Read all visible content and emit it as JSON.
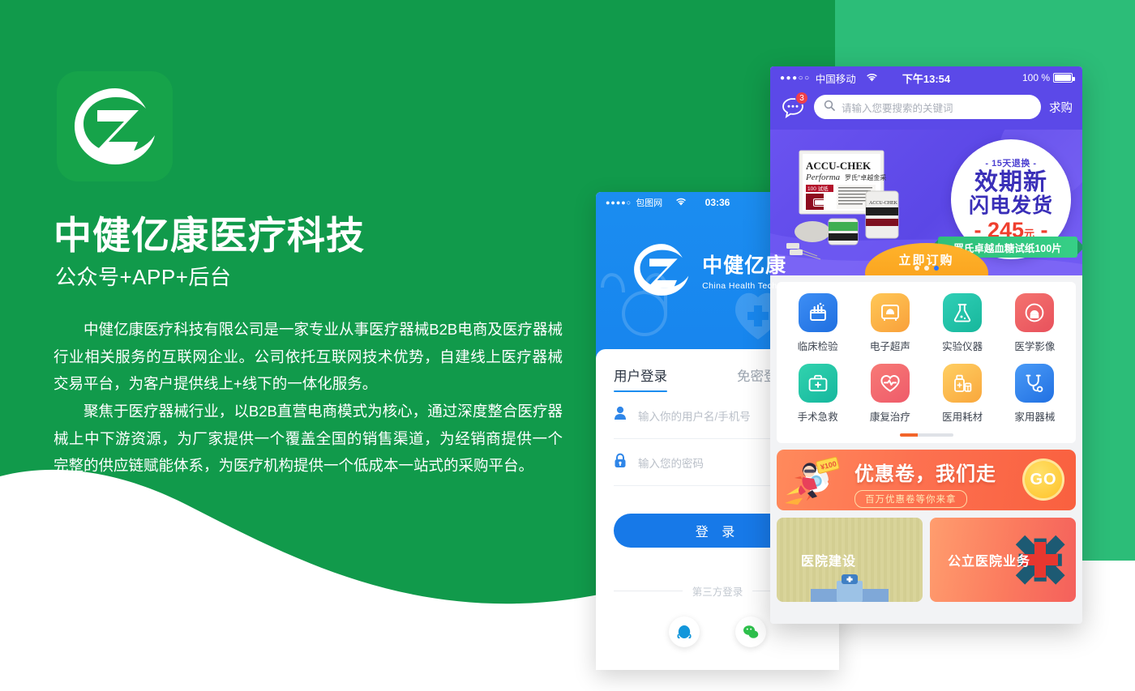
{
  "brand": {
    "logo_letter": "Z",
    "headline": "中健亿康医疗科技",
    "subhead": "公众号+APP+后台",
    "paragraph_1": "中健亿康医疗科技有限公司是一家专业从事医疗器械B2B电商及医疗器械行业相关服务的互联网企业。公司依托互联网技术优势，自建线上医疗器械交易平台，为客户提供线上+线下的一体化服务。",
    "paragraph_2": "聚焦于医疗器械行业，以B2B直营电商模式为核心，通过深度整合医疗器械上中下游资源，为厂家提供一个覆盖全国的销售渠道，为经销商提供一个完整的供应链赋能体系，为医疗机构提供一个低成本一站式的采购平台。"
  },
  "colors": {
    "green_left": "#119a4b",
    "green_right": "#2cbd78",
    "blue": "#1b8df0",
    "purple": "#5b49e8",
    "orange": "#f2642a",
    "badge_red": "#ef3f4a"
  },
  "login_phone": {
    "status": {
      "signal_dots": "●●●●○",
      "carrier": "包图网",
      "wifi_icon": "wifi-icon",
      "time": "03:36"
    },
    "brand_cn": "中健亿康",
    "brand_en": "China Health Technology",
    "tabs": [
      {
        "label": "用户登录",
        "active": true
      },
      {
        "label": "免密登录",
        "active": false
      }
    ],
    "fields": [
      {
        "icon": "user-icon",
        "placeholder": "输入你的用户名/手机号",
        "value": ""
      },
      {
        "icon": "lock-icon",
        "placeholder": "输入您的密码",
        "value": ""
      }
    ],
    "submit_label": "登 录",
    "third_party_label": "第三方登录",
    "socials": [
      {
        "name": "qq-icon",
        "color": "#1296db"
      },
      {
        "name": "wechat-icon",
        "color": "#2ec04c"
      }
    ]
  },
  "shop_phone": {
    "status": {
      "signal_dots": "●●●○○",
      "carrier": "中国移动",
      "wifi_icon": "wifi-icon",
      "time": "下午13:54",
      "battery": "100 %"
    },
    "header": {
      "chat_icon": "chat-bubble-icon",
      "chat_badge": "3",
      "search_icon": "search-icon",
      "search_placeholder": "请输入您要搜索的关键词",
      "search_value": "",
      "buy_request_label": "求购"
    },
    "banner": {
      "product_brand": "ACCU-CHEK",
      "product_model": "Performa",
      "product_cn": "罗氏°卓越金采",
      "product_count": "100 试纸",
      "tag": "- 15天退换 -",
      "title_line1": "效期新",
      "title_line2": "闪电发货",
      "price": "245",
      "price_unit": "元",
      "ribbon": "罗氏卓越血糖试纸100片",
      "cta": "立即订购",
      "dots_total": 3,
      "dot_active_index": 2
    },
    "categories": [
      {
        "label": "临床检验",
        "icon": "test-tube-rack-icon",
        "color_from": "#3d8ef5",
        "color_to": "#1f6fe0"
      },
      {
        "label": "电子超声",
        "icon": "ultrasound-monitor-icon",
        "color_from": "#ffc857",
        "color_to": "#f9a03a"
      },
      {
        "label": "实验仪器",
        "icon": "flask-icon",
        "color_from": "#30cfb6",
        "color_to": "#17b79c"
      },
      {
        "label": "医学影像",
        "icon": "mri-scanner-icon",
        "color_from": "#f4736f",
        "color_to": "#e8515c"
      },
      {
        "label": "手术急救",
        "icon": "first-aid-kit-icon",
        "color_from": "#31d3ae",
        "color_to": "#16b79e"
      },
      {
        "label": "康复治疗",
        "icon": "heart-pulse-icon",
        "color_from": "#f77a76",
        "color_to": "#ef5b6a"
      },
      {
        "label": "医用耗材",
        "icon": "medicine-bottle-icon",
        "color_from": "#ffcf63",
        "color_to": "#f9a73c"
      },
      {
        "label": "家用器械",
        "icon": "stethoscope-icon",
        "color_from": "#4a9bf7",
        "color_to": "#2170e2"
      }
    ],
    "category_pager": {
      "pages": 3,
      "active": 1
    },
    "coupon": {
      "title": "优惠卷，我们走",
      "subtitle": "百万优惠卷等你来拿",
      "go_label": "GO",
      "voucher_amount": "¥100"
    },
    "tiles": [
      {
        "label": "医院建设",
        "icon": "hospital-building-icon"
      },
      {
        "label": "公立医院业务",
        "icon": "red-cross-icon"
      }
    ]
  }
}
